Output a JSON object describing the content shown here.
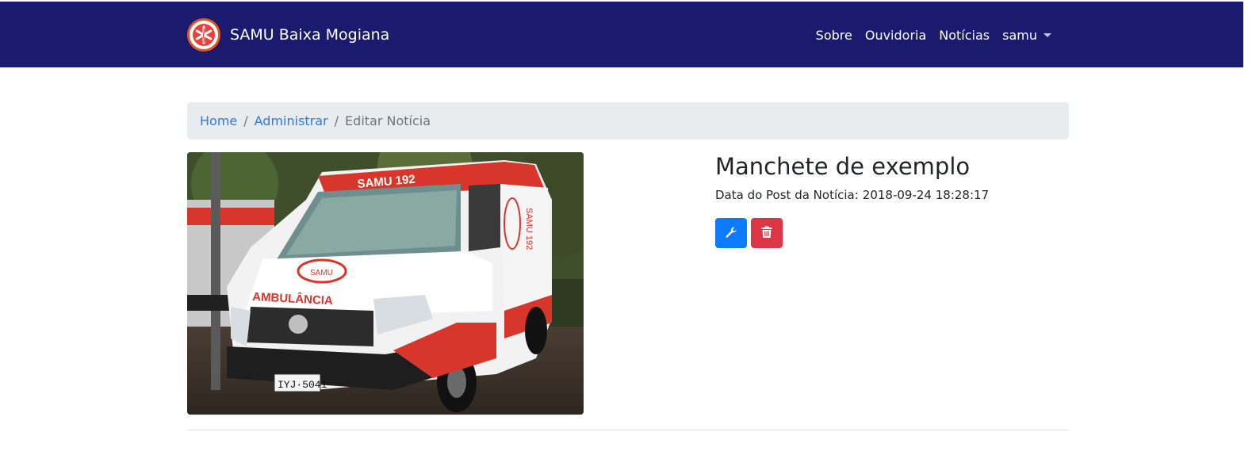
{
  "navbar": {
    "brand": "SAMU Baixa Mogiana",
    "links": [
      {
        "label": "Sobre"
      },
      {
        "label": "Ouvidoria"
      },
      {
        "label": "Notícias"
      }
    ],
    "user_menu": "samu",
    "colors": {
      "background": "#1a1a6e",
      "text": "#ffffff",
      "logo_ring": "#e2571e"
    }
  },
  "breadcrumb": {
    "items": [
      "Home",
      "Administrar"
    ],
    "active": "Editar Notícia"
  },
  "news": {
    "headline": "Manchete de exemplo",
    "date_label": "Data do Post da Notícia:",
    "date_value": "2018-09-24 18:28:17",
    "photo": {
      "subject": "ambulance-photo",
      "roof_text": "SAMU 192",
      "side_text": "SAMU 192",
      "hood_text": "AMBULÂNCIA",
      "plate": "IYJ-5041"
    },
    "actions": [
      {
        "name": "edit",
        "icon": "wrench-icon",
        "color": "#0d7bff"
      },
      {
        "name": "delete",
        "icon": "trash-icon",
        "color": "#dc3545"
      }
    ]
  }
}
